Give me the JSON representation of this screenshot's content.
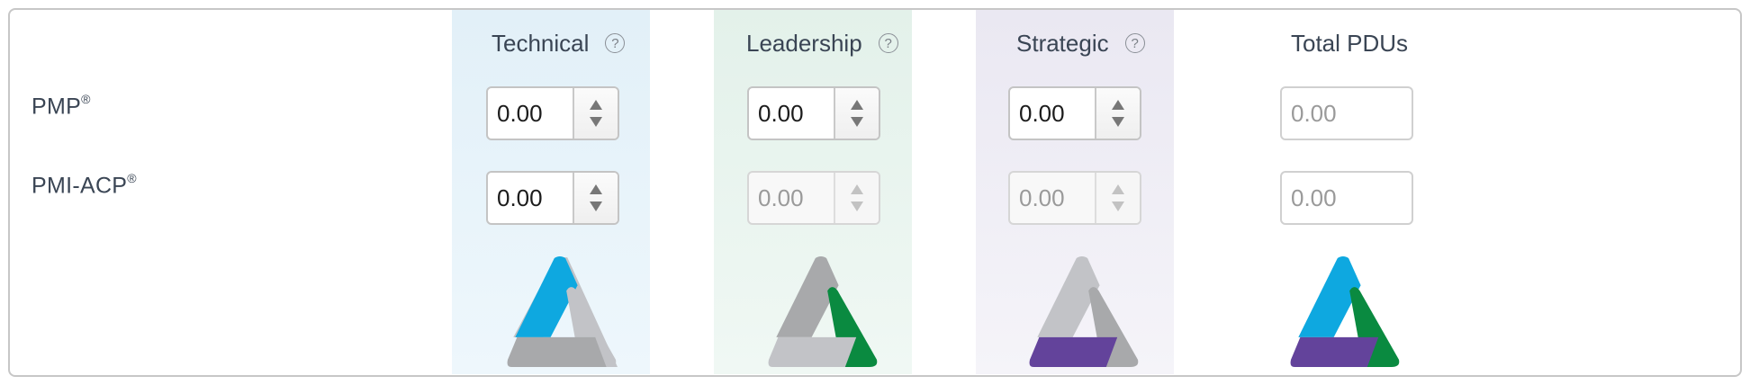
{
  "columns": {
    "technical": {
      "label": "Technical",
      "help": "?"
    },
    "leadership": {
      "label": "Leadership",
      "help": "?"
    },
    "strategic": {
      "label": "Strategic",
      "help": "?"
    },
    "total": {
      "label": "Total PDUs"
    }
  },
  "rows": {
    "pmp": {
      "label": "PMP",
      "mark": "®",
      "technical": "0.00",
      "leadership": "0.00",
      "strategic": "0.00",
      "total": "0.00"
    },
    "acp": {
      "label": "PMI-ACP",
      "mark": "®",
      "technical": "0.00",
      "leadership": "0.00",
      "strategic": "0.00",
      "total": "0.00"
    }
  },
  "state": {
    "acp_leadership_disabled": true,
    "acp_strategic_disabled": true
  },
  "colors": {
    "technical_blue": "#0ea8e0",
    "leadership_green": "#0a8a40",
    "strategic_purple": "#63439b",
    "inactive_gray": "#a8a9ab",
    "inactive_light": "#c2c3c7"
  },
  "icons": {
    "help": "question-circle-icon",
    "increment": "triangle-up-icon",
    "decrement": "triangle-down-icon",
    "logo": "talent-triangle-logo"
  }
}
